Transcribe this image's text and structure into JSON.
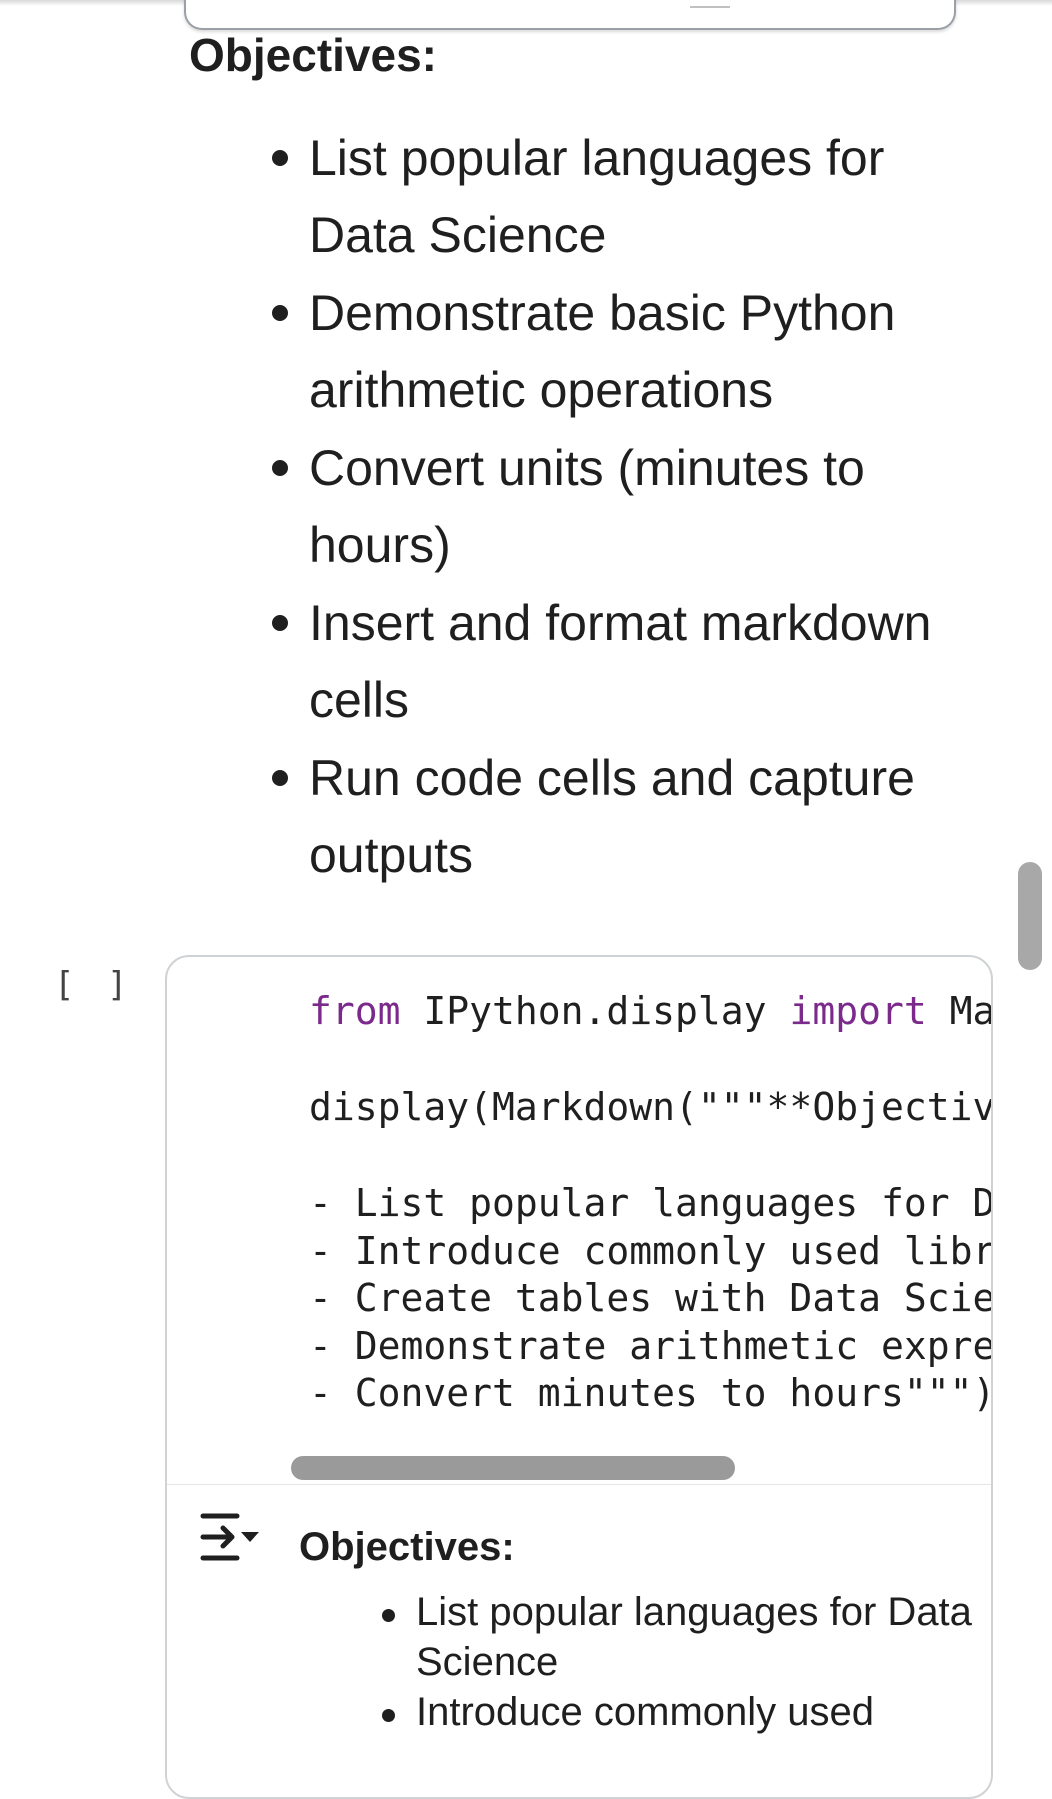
{
  "markdown_cell": {
    "heading": "Objectives:",
    "items": [
      "List popular languages for Data Science",
      "Demonstrate basic Python arithmetic operations",
      "Convert units (minutes to hours)",
      "Insert and format markdown cells",
      "Run code cells and capture outputs"
    ]
  },
  "code_cell": {
    "exec_count": "[ ]",
    "lines": {
      "l1_kw1": "from",
      "l1_mid": " IPython.display ",
      "l1_kw2": "import",
      "l1_end": " Ma",
      "l2": "display(Markdown(\"\"\"**Objectiv",
      "l3": "- List popular languages for D",
      "l4": "- Introduce commonly used libr",
      "l5": "- Create tables with Data Scie",
      "l6": "- Demonstrate arithmetic expre",
      "l7": "- Convert minutes to hours\"\"\")"
    },
    "output": {
      "icon": "output-toggle-icon",
      "heading": "Objectives:",
      "items": [
        "List popular languages for Data Science",
        "Introduce commonly used"
      ]
    }
  },
  "colors": {
    "keyword": "#7b2a8c",
    "text": "#1f1f1f",
    "cell_border": "#d0d3d6",
    "scrollbar": "#a8a8a8"
  }
}
